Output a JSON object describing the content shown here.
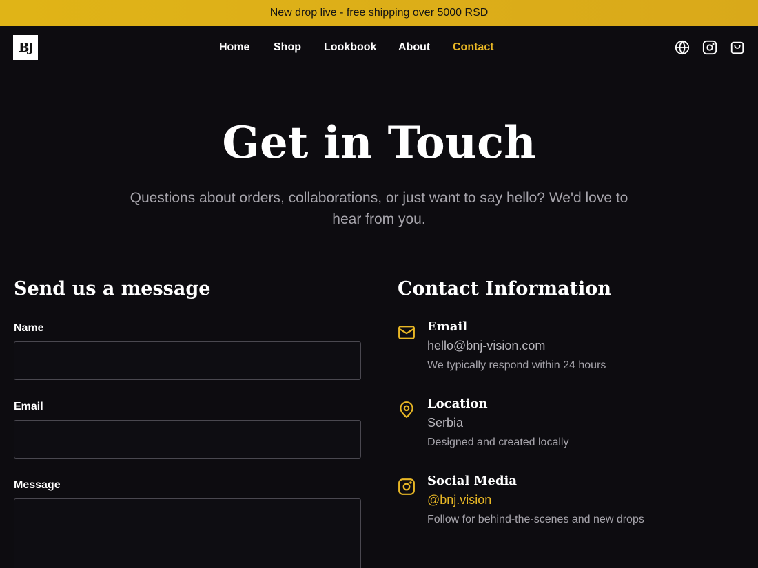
{
  "announcement": {
    "text": "New drop live - free shipping over 5000 RSD"
  },
  "brand": {
    "logo_text": "BJ"
  },
  "nav": {
    "items": [
      {
        "label": "Home"
      },
      {
        "label": "Shop"
      },
      {
        "label": "Lookbook"
      },
      {
        "label": "About"
      },
      {
        "label": "Contact"
      }
    ],
    "active": "Contact",
    "icons": [
      "globe-icon",
      "instagram-icon",
      "shopping-bag-icon"
    ]
  },
  "hero": {
    "title": "Get in Touch",
    "subtitle": "Questions about orders, collaborations, or just want to say hello? We'd love to hear from you."
  },
  "form": {
    "title": "Send us a message",
    "name_label": "Name",
    "name_value": "",
    "email_label": "Email",
    "email_value": "",
    "message_label": "Message",
    "message_value": ""
  },
  "contact_info": {
    "title": "Contact Information",
    "items": [
      {
        "icon": "mail-icon",
        "title": "Email",
        "value": "hello@bnj-vision.com",
        "note": "We typically respond within 24 hours"
      },
      {
        "icon": "map-pin-icon",
        "title": "Location",
        "value": "Serbia",
        "note": "Designed and created locally"
      },
      {
        "icon": "instagram-icon",
        "title": "Social Media",
        "value": "@bnj.vision",
        "note": "Follow for behind-the-scenes and new drops"
      }
    ]
  },
  "colors": {
    "accent": "#e8b725",
    "announcement_bg": "#deb11a",
    "background": "#0d0c10",
    "muted_text": "#a6a4ab"
  }
}
